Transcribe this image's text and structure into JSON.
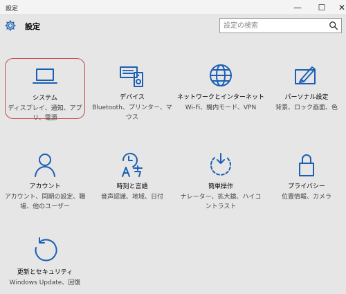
{
  "window": {
    "title": "設定",
    "minimize_glyph": "—",
    "maximize_glyph": "☐",
    "close_glyph": "✕"
  },
  "header": {
    "app_title": "設定",
    "search_placeholder": "設定の検索"
  },
  "accent_color": "#1a5fb4",
  "selection_color": "#c84848",
  "tiles": [
    {
      "name": "システム",
      "description": "ディスプレイ、通知、アプリ、電源",
      "icon": "laptop-icon",
      "selected": true
    },
    {
      "name": "デバイス",
      "description": "Bluetooth、プリンター、マウス",
      "icon": "devices-icon",
      "selected": false
    },
    {
      "name": "ネットワークとインターネット",
      "description": "Wi-Fi、機内モード、VPN",
      "icon": "globe-icon",
      "selected": false
    },
    {
      "name": "パーソナル設定",
      "description": "背景、ロック画面、色",
      "icon": "paint-icon",
      "selected": false
    },
    {
      "name": "アカウント",
      "description": "アカウント、同期の設定、職場、他のユーザー",
      "icon": "person-icon",
      "selected": false
    },
    {
      "name": "時刻と言語",
      "description": "音声認識、地域、日付",
      "icon": "time-language-icon",
      "selected": false
    },
    {
      "name": "簡単操作",
      "description": "ナレーター、拡大鏡、ハイコントラスト",
      "icon": "ease-of-access-icon",
      "selected": false
    },
    {
      "name": "プライバシー",
      "description": "位置情報、カメラ",
      "icon": "lock-icon",
      "selected": false
    },
    {
      "name": "更新とセキュリティ",
      "description": "Windows Update、回復",
      "icon": "refresh-icon",
      "selected": false
    }
  ]
}
